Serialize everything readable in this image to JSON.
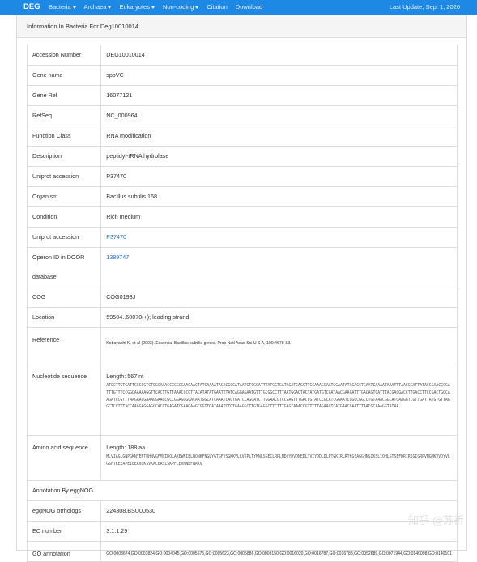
{
  "navbar": {
    "brand": "DEG",
    "items": [
      "Bacteria",
      "Archaea",
      "Eukaryotes",
      "Non-coding",
      "Citation",
      "Download"
    ],
    "dropdowns": [
      true,
      true,
      true,
      true,
      false,
      false
    ],
    "update": "Last Update, Sep. 1, 2020",
    "color": "#1e88e5"
  },
  "panel": {
    "heading": "Information In Bacteria For Deg10010014"
  },
  "rows": [
    {
      "key": "Accession Number",
      "value": "DEG10010014"
    },
    {
      "key": "Gene name",
      "value": "spoVC"
    },
    {
      "key": "Gene Ref",
      "value": "16077121"
    },
    {
      "key": "RefSeq",
      "value": "NC_000964"
    },
    {
      "key": "Function Class",
      "value": "RNA modification"
    },
    {
      "key": "Description",
      "value": "peptidyl-tRNA hydrolase"
    },
    {
      "key": "Uniprot accession",
      "value": "P37470"
    },
    {
      "key": "Organism",
      "value": "Bacillus subtilis 168"
    },
    {
      "key": "Condition",
      "value": "Rich medium"
    },
    {
      "key": "Uniprot accession",
      "value": "P37470"
    },
    {
      "key": "Operon ID in DOOR database",
      "value": "1389747"
    },
    {
      "key": "COG",
      "value": "COG0193J"
    },
    {
      "key": "Location",
      "value": "59504..60070(+); leading strand"
    }
  ],
  "reference": {
    "key": "Reference",
    "value": "Kobayashi K, et al (2003). Essential Bacillus subtilis genes. Proc Natl Acad Sci U S A, 100:4678-83."
  },
  "nucleotide": {
    "key": "Nucleotide sequence",
    "length": "Length: 567 nt",
    "sequence": "ATGCTTGTGATTGGCGGTCTCGGAAACCCGGGGAAGAACTATGAAAATACACGGCATAATGTCGGATTTATGGTGATAGATCAGCTTGCAAAGGAATGGAATATAGAGCTGAATCAAAATAAATTTAACGGATTATACGGAACCGGATTTGTTTCCGGCAAAAAGGTTCACTTGTTAAACCCGTTACATATATGAATTTATCAGGAGAATGTTTGCGGCCTTTAATGGACTACTATGATGTCGATAACGAAGATTTGACAGTCATTTACGACGACCTTGACCTTCCGACTGGCAAGATCCGTTTAAGAACGAAAGGAAGCGCCGGAGGGCACAATGGCATCAAATCACTGATCCAGCATCTTGGAACGTCCGAGTTTGACCGTATCCGCATCGGAATCGGCCGGCCTGTAAACGGCATGAAGGTCGTTGATTATGTGTTAGGCTCCTTTACCAAGGAGGAGGCACCTGAGATCGAAGAAGCGGTTGATAAATCTGTGAAGGCTTGTGAGGCTTCTTTGAGTAAACCGTTTTTAGAAGTCATGAACGAATTTAACGCAAAGGTATAA"
  },
  "aminoacid": {
    "key": "Amino acid sequence",
    "length": "Length: 188 aa",
    "sequence": "MLVIAGLGNPGKNYENTRHNVGFMVIDQLAKEWNIELNQNKFNGLYGTGFVSGKKVLLVKPLTYMNLSGECLRPLMDYYDVDNEDLTVIYDDLDLPTGKIRLRTKGSAGGHNGIKSLIQHLGTSEFDRIRIGIGRPVNGMKVVDYVLGSFTKEEAPEIEEAVDKSVKACEASLSKPFLEVMNEFNAKV"
  },
  "eggnog_header": "Annotation By eggNOG",
  "eggnog_rows": [
    {
      "key": "eggNOG otrhologs",
      "value": "224308.BSU00530"
    },
    {
      "key": "EC number",
      "value": "3.1.1.29"
    }
  ],
  "go": {
    "key": "GO annotation",
    "value": "GO:0003674,GO:0003824,GO:0004045,GO:0005575,GO:0005623,GO:0005886,GO:0008150,GO:0016020,GO:0016787,GO:0016788,GO:0052689,GO:0071944,GO:0140098,GO:0140101"
  },
  "watermark": "知乎 @苏祈"
}
